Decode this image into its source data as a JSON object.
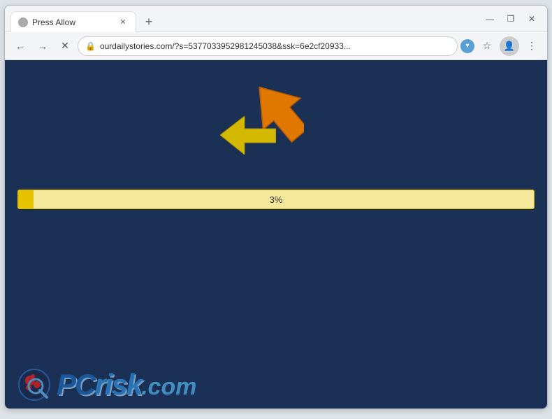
{
  "browser": {
    "tab": {
      "title": "Press Allow",
      "favicon_color": "#aaa"
    },
    "new_tab_label": "+",
    "window_controls": {
      "minimize": "—",
      "maximize": "❐",
      "close": "✕"
    },
    "nav": {
      "back_label": "←",
      "forward_label": "→",
      "reload_label": "✕"
    },
    "address": {
      "url": "ourdailystories.com/?s=5377033952981245038&ssk=6e2cf20933...",
      "lock_icon": "🔒"
    },
    "toolbar_icons": {
      "star": "☆",
      "profile": "👤",
      "menu": "⋮",
      "dropdown": "▾"
    }
  },
  "page": {
    "background_color": "#1a3055",
    "progress": {
      "value": 3,
      "label": "3%",
      "fill_color": "#e6c200",
      "bar_color": "#f5e89a"
    },
    "arrows": {
      "orange_color": "#e07800",
      "yellow_color": "#d4b800"
    }
  },
  "watermark": {
    "brand": "PC",
    "brand2": "risk",
    "dotcom": ".com"
  }
}
